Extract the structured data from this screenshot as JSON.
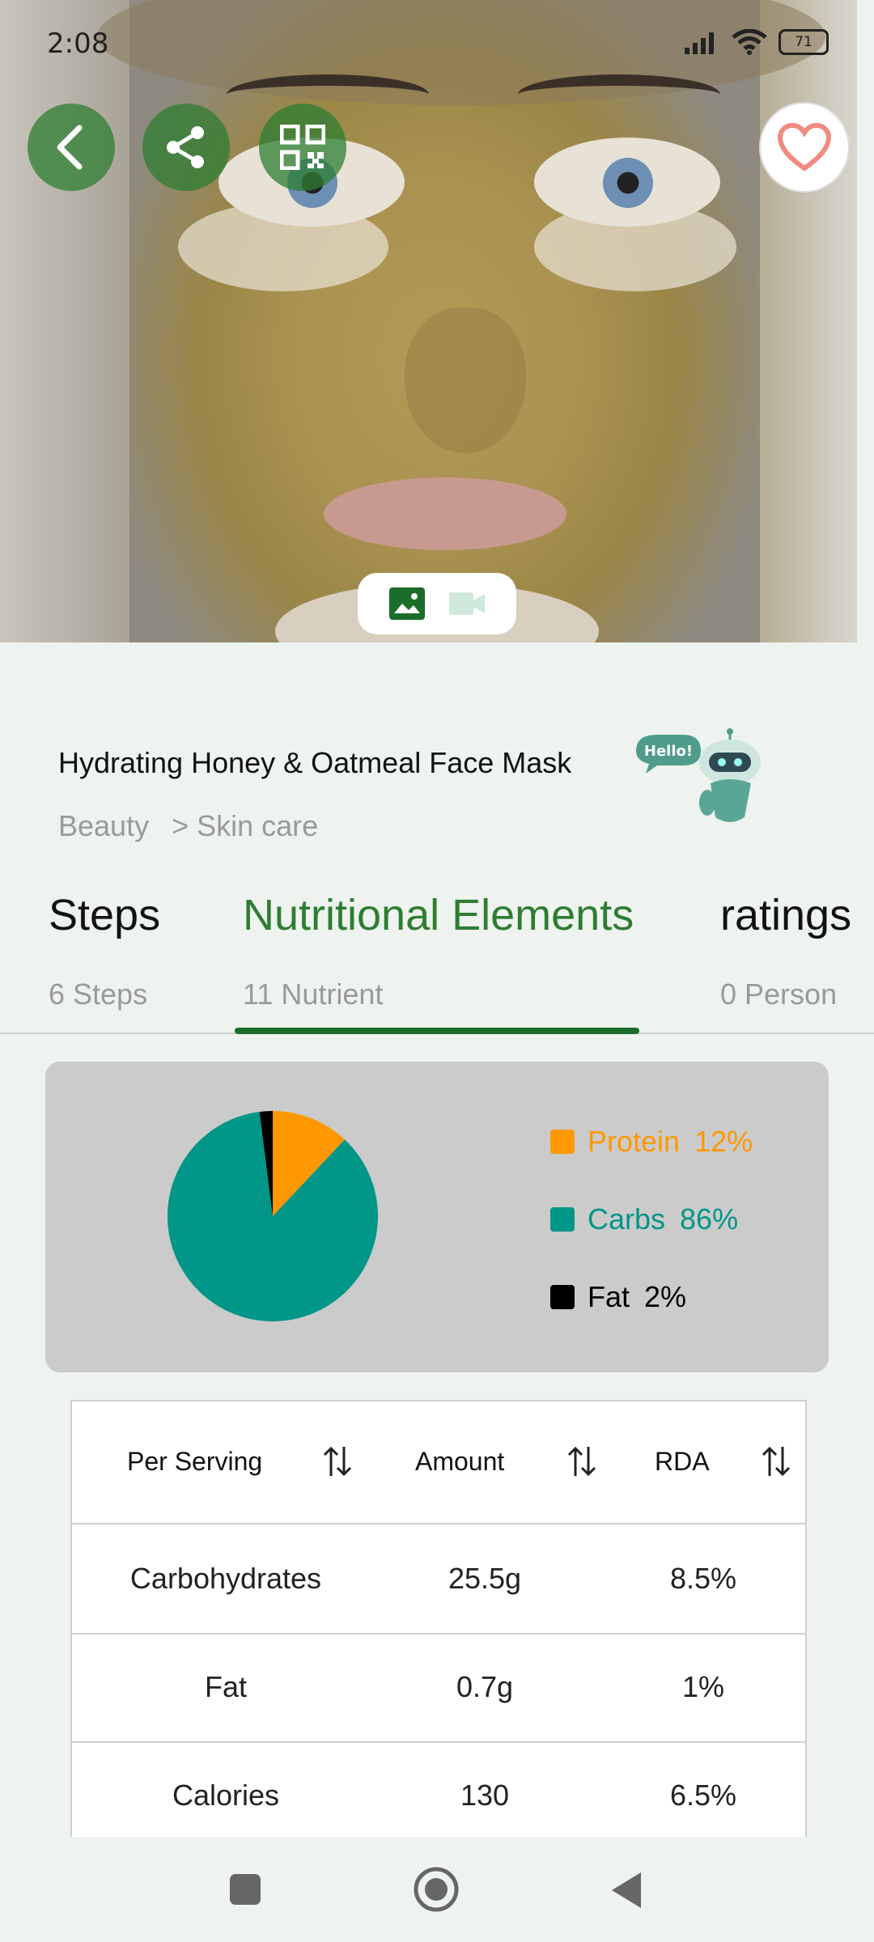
{
  "status_bar": {
    "time": "2:08",
    "battery": "71"
  },
  "recipe": {
    "title": "Hydrating Honey & Oatmeal Face Mask",
    "category": "Beauty",
    "subcategory": "> Skin care",
    "assistant_greeting": "Hello!"
  },
  "tabs": [
    {
      "label": "Steps",
      "sub": "6 Steps"
    },
    {
      "label": "Nutritional Elements",
      "sub": "11 Nutrient"
    },
    {
      "label": "ratings",
      "sub": "0 Person"
    }
  ],
  "chart_data": {
    "type": "pie",
    "slices": [
      {
        "label": "Protein",
        "value": 12,
        "color": "#ff9800"
      },
      {
        "label": "Carbs",
        "value": 86,
        "color": "#009688"
      },
      {
        "label": "Fat",
        "value": 2,
        "color": "#000000"
      }
    ],
    "legend_position": "right"
  },
  "legend": [
    {
      "label": "Protein",
      "pct": "12%",
      "color": "#ff9800"
    },
    {
      "label": "Carbs",
      "pct": "86%",
      "color": "#009688"
    },
    {
      "label": "Fat",
      "pct": "2%",
      "color": "#000000"
    }
  ],
  "table": {
    "headers": [
      "Per Serving",
      "Amount",
      "RDA"
    ],
    "rows": [
      [
        "Carbohydrates",
        "25.5g",
        "8.5%"
      ],
      [
        "Fat",
        "0.7g",
        "1%"
      ],
      [
        "Calories",
        "130",
        "6.5%"
      ]
    ]
  },
  "colors": {
    "accent": "#2e7d32",
    "background": "#eef3ef"
  }
}
